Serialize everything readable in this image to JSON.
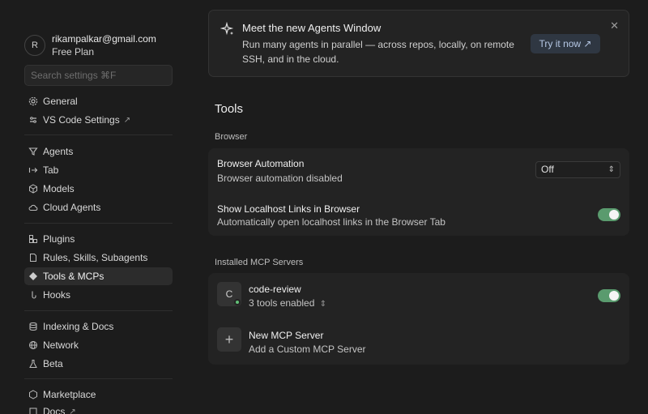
{
  "user": {
    "avatar_letter": "R",
    "email": "rikampalkar@gmail.com",
    "plan": "Free Plan"
  },
  "search": {
    "placeholder": "Search settings ⌘F"
  },
  "sidebar": {
    "groups": [
      [
        {
          "label": "General",
          "icon": "gear-icon"
        },
        {
          "label": "VS Code Settings",
          "icon": "vscode-icon",
          "external": true
        }
      ],
      [
        {
          "label": "Agents",
          "icon": "filter-icon"
        },
        {
          "label": "Tab",
          "icon": "tab-icon"
        },
        {
          "label": "Models",
          "icon": "cube-icon"
        },
        {
          "label": "Cloud Agents",
          "icon": "cloud-icon"
        }
      ],
      [
        {
          "label": "Plugins",
          "icon": "plugin-icon"
        },
        {
          "label": "Rules, Skills, Subagents",
          "icon": "document-icon"
        },
        {
          "label": "Tools & MCPs",
          "icon": "tools-icon",
          "active": true
        },
        {
          "label": "Hooks",
          "icon": "hook-icon"
        }
      ],
      [
        {
          "label": "Indexing & Docs",
          "icon": "database-icon"
        },
        {
          "label": "Network",
          "icon": "globe-icon"
        },
        {
          "label": "Beta",
          "icon": "flask-icon"
        }
      ],
      [
        {
          "label": "Marketplace",
          "icon": "marketplace-icon"
        },
        {
          "label": "Docs",
          "icon": "book-icon",
          "external": true
        }
      ]
    ],
    "external_glyph": "↗"
  },
  "banner": {
    "title": "Meet the new Agents Window",
    "body": "Run many agents in parallel — across repos, locally, on remote SSH, and in the cloud.",
    "button": "Try it now ↗",
    "close": "✕"
  },
  "page": {
    "title": "Tools"
  },
  "browser": {
    "section_label": "Browser",
    "automation_title": "Browser Automation",
    "automation_desc": "Browser automation disabled",
    "automation_value": "Off",
    "localhost_title": "Show Localhost Links in Browser",
    "localhost_desc": "Automatically open localhost links in the Browser Tab",
    "localhost_enabled": true
  },
  "mcp": {
    "section_label": "Installed MCP Servers",
    "server_letter": "C",
    "server_name": "code-review",
    "server_tools": "3 tools enabled",
    "server_enabled": true,
    "new_title": "New MCP Server",
    "new_desc": "Add a Custom MCP Server",
    "new_icon_glyph": "+"
  },
  "colors": {
    "toggle_on": "#5a9b6e",
    "status_dot": "#62c077",
    "accent_button_bg": "#2f3742",
    "accent_button_text": "#b5c7e4"
  }
}
